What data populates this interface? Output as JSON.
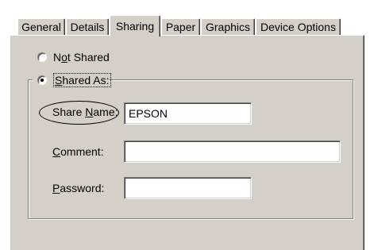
{
  "tabs": [
    {
      "label": "General"
    },
    {
      "label": "Details"
    },
    {
      "label": "Sharing"
    },
    {
      "label": "Paper"
    },
    {
      "label": "Graphics"
    },
    {
      "label": "Device Options"
    }
  ],
  "sharing": {
    "not_shared": {
      "pre": "N",
      "ul": "o",
      "post": "t Shared",
      "checked": false
    },
    "shared_as": {
      "ul": "S",
      "post": "hared As:",
      "checked": true
    },
    "share_name": {
      "pre": "Share ",
      "ul": "N",
      "post": "ame:",
      "value": "EPSON"
    },
    "comment": {
      "ul": "C",
      "post": "omment:",
      "value": ""
    },
    "password": {
      "ul": "P",
      "post": "assword:",
      "value": ""
    }
  }
}
